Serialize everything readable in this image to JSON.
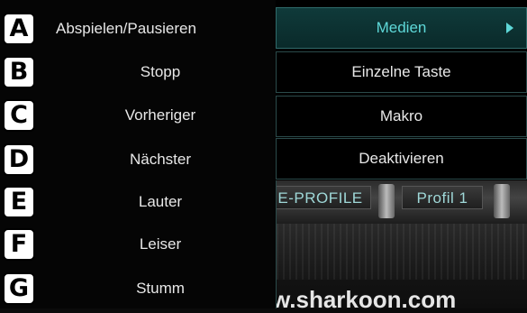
{
  "left_menu": {
    "items": [
      {
        "key": "A",
        "label": "Abspielen/Pausieren"
      },
      {
        "key": "B",
        "label": "Stopp"
      },
      {
        "key": "C",
        "label": "Vorheriger"
      },
      {
        "key": "D",
        "label": "Nächster"
      },
      {
        "key": "E",
        "label": "Lauter"
      },
      {
        "key": "F",
        "label": "Leiser"
      },
      {
        "key": "G",
        "label": "Stumm"
      }
    ]
  },
  "right_menu": {
    "items": [
      {
        "label": "Medien",
        "active": true
      },
      {
        "label": "Einzelne Taste"
      },
      {
        "label": "Makro"
      },
      {
        "label": "Deaktivieren"
      }
    ]
  },
  "background": {
    "profile_tab_e": "E-PROFILE",
    "profile_tab_1": "Profil 1",
    "website": "w.sharkoon.com"
  },
  "colors": {
    "accent": "#5ed8d8",
    "active_bg": "#0f3a3a"
  },
  "icons": {
    "submenu_arrow": "triangle-right"
  }
}
